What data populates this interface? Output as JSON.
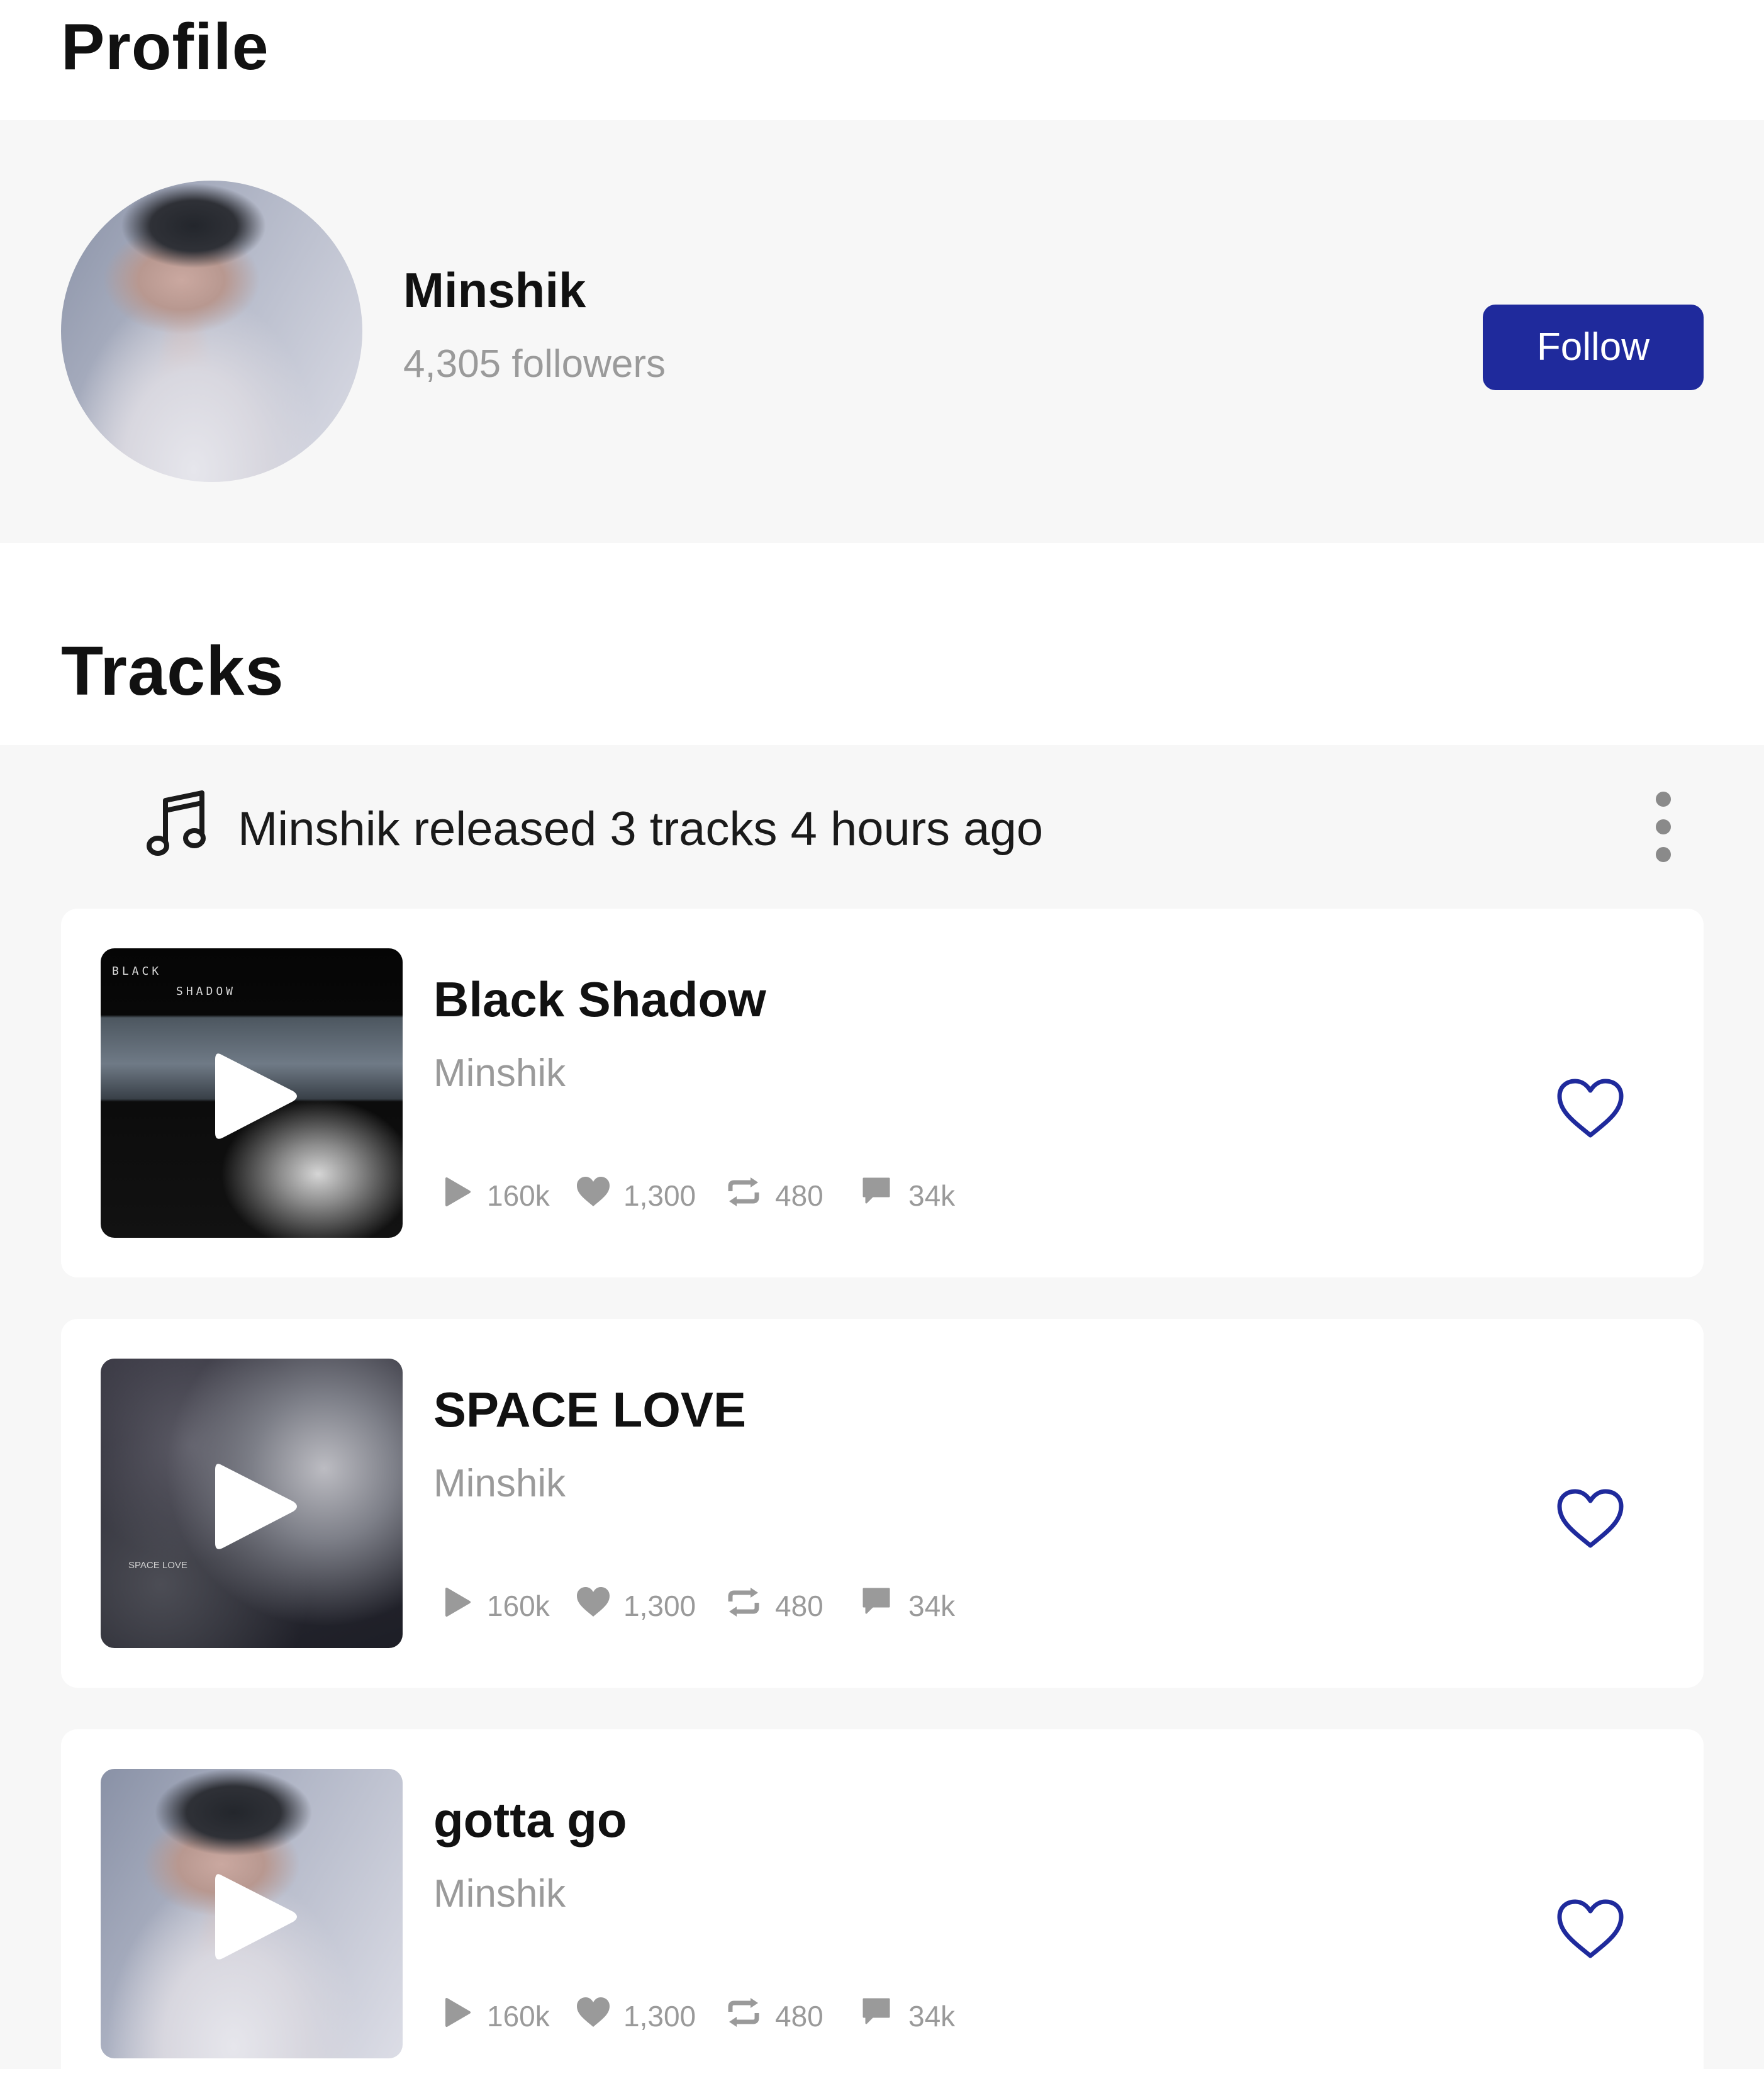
{
  "header": {
    "title": "Profile"
  },
  "profile": {
    "name": "Minshik",
    "followers": "4,305 followers",
    "follow_label": "Follow"
  },
  "tracks_section": {
    "title": "Tracks",
    "release_text": "Minshik released 3 tracks 4 hours ago"
  },
  "colors": {
    "accent": "#1f2a9c",
    "band_background": "#f7f7f7",
    "muted_text": "#9a9a9a"
  },
  "icons": {
    "release": "music-note-icon",
    "more": "more-vertical-icon",
    "play": "play-icon",
    "plays": "play-count-icon",
    "likes": "heart-filled-icon",
    "reposts": "repost-icon",
    "comments": "comment-icon",
    "like_action": "heart-outline-icon"
  },
  "tracks": [
    {
      "title": "Black Shadow",
      "artist": "Minshik",
      "cover_text": [
        "BLACK",
        "SHADOW"
      ],
      "stats": {
        "plays": "160k",
        "likes": "1,300",
        "reposts": "480",
        "comments": "34k"
      }
    },
    {
      "title": "SPACE LOVE",
      "artist": "Minshik",
      "cover_text": [
        "SPACE LOVE"
      ],
      "stats": {
        "plays": "160k",
        "likes": "1,300",
        "reposts": "480",
        "comments": "34k"
      }
    },
    {
      "title": "gotta go",
      "artist": "Minshik",
      "cover_text": [],
      "stats": {
        "plays": "160k",
        "likes": "1,300",
        "reposts": "480",
        "comments": "34k"
      }
    }
  ]
}
